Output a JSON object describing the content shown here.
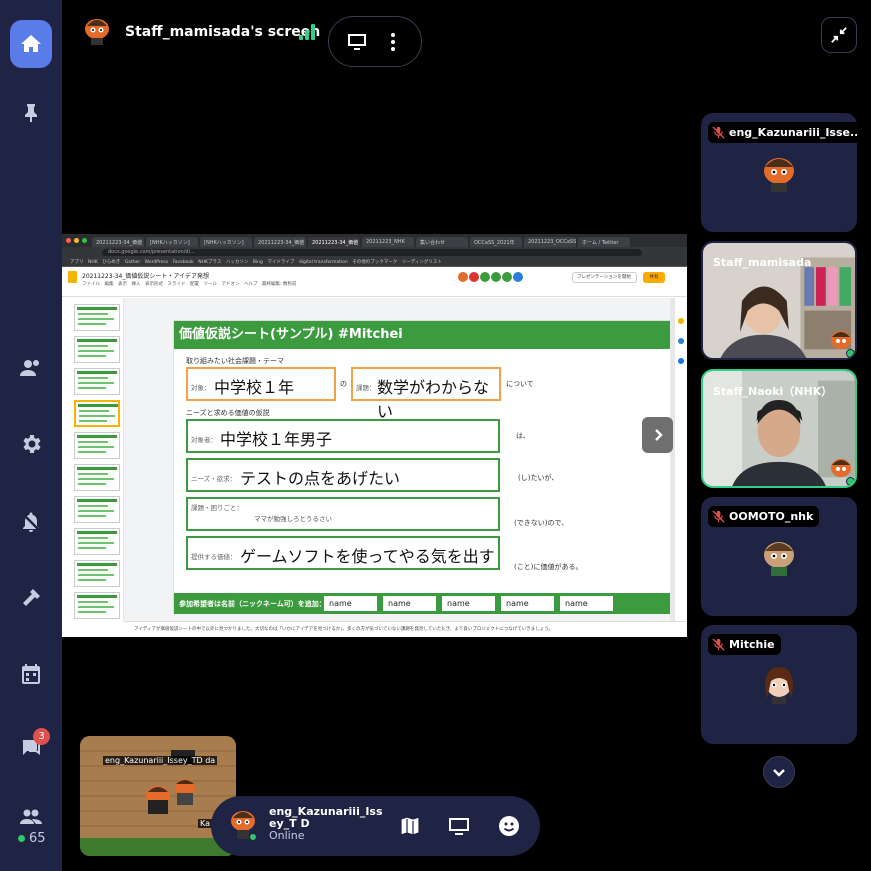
{
  "header": {
    "screen_title": "Staff_mamisada's screen"
  },
  "sidebar": {
    "chat_badge": "3",
    "online_count": "65"
  },
  "shared_screen": {
    "doc_title": "20211223-34_価値仮説シート・アイデア発想",
    "doc_menu": "ファイル　編集　表示　挿入　表示形式　スライド　配置　ツール　アドオン　ヘルプ　最終編集: 数秒前",
    "url": "docs.google.com/presentation/d/...",
    "tabs": [
      "20211223-34_価値",
      "[NHKハッカソン]",
      "[NHKハッカソン]",
      "20211223-34_価値",
      "20211223-34_価値",
      "20211223_NHK",
      "集い合わせ",
      "OCCaSS_2021年",
      "20211223_OCCaSS",
      "ホーム / Twitter"
    ],
    "bookmarks": "アプリ　NHK　ひらめき　Gather　WordPress　Facebook　NHKプラス　ハッカソン　Bing　マイドライブ　digital transformation　その他のブックマーク　リーディングリスト",
    "present_label": "プレゼンテーションを開始",
    "share_label": "共有",
    "notes_text": "アイディアが価値仮説シートの中で以外に見つかりました。大切なのは「いかにアイデアを見つけるか」。多くの方が気づいていない課題を発見していただき、より良いプロジェクトにつなげていきましょう。",
    "slide": {
      "title": "価値仮説シート(サンプル) #Mitchei",
      "section1": "取り組みたい社会課題・テーマ",
      "target_label": "対象：",
      "target_value": "中学校１年",
      "no": "の",
      "problem_label": "課題：",
      "problem_value": "数学がわからない",
      "about": "について",
      "section2": "ニーズと求める価値の仮説",
      "customer_label": "対象者：",
      "customer_value": "中学校１年男子",
      "wa": "は、",
      "needs_label": "ニーズ・欲求：",
      "needs_value": "テストの点をあげたい",
      "shitai": "(し)たいが、",
      "pain_label": "課題・困りごと：",
      "pain_value": "ママが勉強しろとうるさい",
      "dekinai": "(できない)ので、",
      "value_label": "提供する価値：",
      "value_value": "ゲームソフトを使ってやる気を出す",
      "kachi": "(こと)に価値がある。",
      "footer_label": "参加希望者は名前（ニックネーム可）を追加：",
      "names": [
        "name",
        "name",
        "name",
        "name",
        "name"
      ]
    }
  },
  "participants": [
    {
      "name": "eng_Kazunariii_Isse...",
      "muted": true
    },
    {
      "name": "Staff_mamisada",
      "muted": false
    },
    {
      "name": "Staff_Naoki（NHK）",
      "muted": false
    },
    {
      "name": "OOMOTO_nhk",
      "muted": true
    },
    {
      "name": "Mitchie",
      "muted": true
    }
  ],
  "minimap": {
    "label_top": "eng_Kazunariii_Issey_TD da",
    "label_bottom": "Ka"
  },
  "bottom_bar": {
    "name": "eng_Kazunariii_Issey_T D",
    "status": "Online"
  },
  "colors": {
    "sidebar_bg": "#1f2344",
    "accent": "#5a7ce8",
    "online": "#2fc76a",
    "slide_green": "#3d9b3f",
    "slide_orange": "#f1a14a"
  }
}
